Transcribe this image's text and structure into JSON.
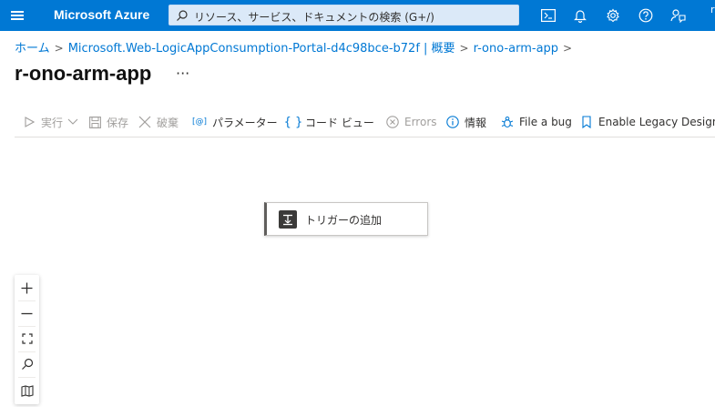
{
  "topbar": {
    "brand": "Microsoft Azure",
    "search_placeholder": "リソース、サービス、ドキュメントの検索 (G+/)",
    "account_initial": "r",
    "icons": [
      "cloud-shell-icon",
      "bell-icon",
      "gear-icon",
      "help-icon",
      "feedback-icon"
    ]
  },
  "breadcrumb": {
    "home": "ホーム",
    "deployment": "Microsoft.Web-LogicAppConsumption-Portal-d4c98bce-b72f | 概要",
    "resource": "r-ono-arm-app"
  },
  "page": {
    "title": "r-ono-arm-app",
    "more": "···"
  },
  "toolbar": {
    "run": "実行",
    "save": "保存",
    "discard": "破棄",
    "parameters": "パラメーター",
    "code_view": "コード ビュー",
    "errors": "Errors",
    "info": "情報",
    "file_bug": "File a bug",
    "legacy_designer": "Enable Legacy Designer"
  },
  "canvas": {
    "trigger_label": "トリガーの追加"
  },
  "colors": {
    "accent": "#0078d4",
    "disabled": "#a19f9d"
  }
}
